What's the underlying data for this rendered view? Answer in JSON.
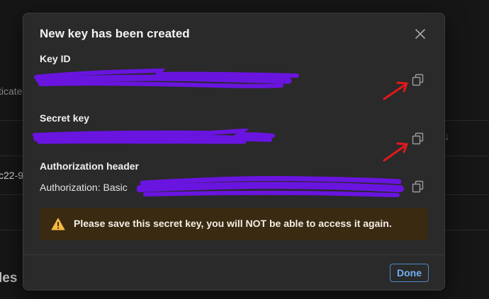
{
  "background": {
    "fragment_left": "ticate",
    "fragment_row": "c22-9",
    "heading_fragment": "les"
  },
  "modal": {
    "title": "New key has been created",
    "fields": [
      {
        "label": "Key ID",
        "value": ""
      },
      {
        "label": "Secret key",
        "value": ""
      },
      {
        "label": "Authorization header",
        "value": "Authorization: Basic"
      }
    ],
    "warning": "Please save this secret key, you will NOT be able to access it again.",
    "done_label": "Done"
  },
  "icons": {
    "close": "close-icon",
    "copy": "copy-icon",
    "warning": "warning-triangle-icon",
    "background_sort": "arrow-down-icon"
  },
  "colors": {
    "redaction": "#6a14e0",
    "annotation_arrow": "#e0191c",
    "warning_bg": "#3a2a12",
    "warning_icon": "#f5b942",
    "done_accent": "#6fb0f2"
  }
}
